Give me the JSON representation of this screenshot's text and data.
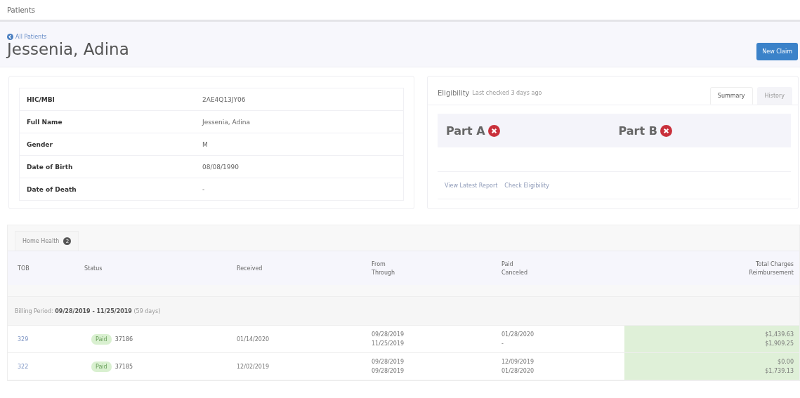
{
  "breadcrumb": "Patients",
  "back_link": "All Patients",
  "patient_name": "Jessenia, Adina",
  "new_claim_button": "New Claim",
  "details": [
    {
      "label": "HIC/MBI",
      "value": "2AE4Q13JY06"
    },
    {
      "label": "Full Name",
      "value": "Jessenia, Adina"
    },
    {
      "label": "Gender",
      "value": "M"
    },
    {
      "label": "Date of Birth",
      "value": "08/08/1990"
    },
    {
      "label": "Date of Death",
      "value": "-"
    }
  ],
  "eligibility": {
    "title": "Eligibility",
    "subtitle": "Last checked 3 days ago",
    "tabs": [
      {
        "label": "Summary",
        "selected": true
      },
      {
        "label": "History",
        "selected": false
      }
    ],
    "parts": [
      {
        "label": "Part A",
        "eligible": false
      },
      {
        "label": "Part B",
        "eligible": false
      }
    ],
    "links": [
      "View Latest Report",
      "Check Eligibility"
    ]
  },
  "claims": {
    "tab": {
      "label": "Home Health",
      "count": "2"
    },
    "columns": [
      [
        "TOB"
      ],
      [
        "Status"
      ],
      [
        "Received"
      ],
      [
        "From",
        "Through"
      ],
      [
        "Paid",
        "Canceled"
      ],
      [
        "Total Charges",
        "Reimbursement"
      ]
    ],
    "group": {
      "label": "Billing Period:",
      "range": "09/28/2019 - 11/25/2019",
      "days": "(59 days)"
    },
    "rows": [
      {
        "tob": "329",
        "status": "Paid",
        "claim": "37186",
        "received": "01/14/2020",
        "from": "09/28/2019",
        "through": "11/25/2019",
        "paid": "01/28/2020",
        "canceled": "-",
        "charges": "$1,439.63",
        "reimbursement": "$1,909.25"
      },
      {
        "tob": "322",
        "status": "Paid",
        "claim": "37185",
        "received": "12/02/2019",
        "from": "09/28/2019",
        "through": "09/28/2019",
        "paid": "12/09/2019",
        "canceled": "01/28/2020",
        "charges": "$0.00",
        "reimbursement": "$1,739.13"
      }
    ]
  }
}
